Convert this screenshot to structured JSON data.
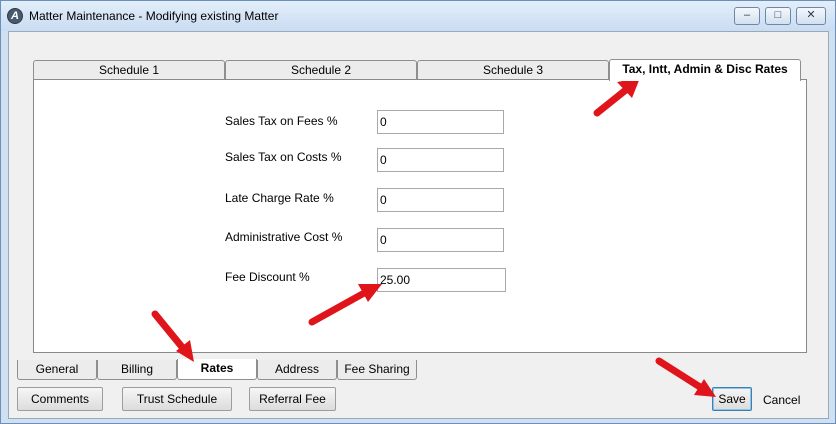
{
  "window": {
    "title": "Matter Maintenance - Modifying existing Matter",
    "min_glyph": "–",
    "max_glyph": "□",
    "close_glyph": "✕"
  },
  "top_tabs": [
    {
      "label": "Schedule 1",
      "active": false
    },
    {
      "label": "Schedule 2",
      "active": false
    },
    {
      "label": "Schedule 3",
      "active": false
    },
    {
      "label": "Tax, Intt, Admin & Disc Rates",
      "active": true
    }
  ],
  "fields": [
    {
      "label": "Sales Tax on Fees %",
      "value": "0"
    },
    {
      "label": "Sales Tax on Costs %",
      "value": "0"
    },
    {
      "label": "Late Charge Rate %",
      "value": "0"
    },
    {
      "label": "Administrative Cost %",
      "value": "0"
    },
    {
      "label": "Fee Discount %",
      "value": "25.00"
    }
  ],
  "bottom_tabs": [
    {
      "label": "General",
      "active": false
    },
    {
      "label": "Billing",
      "active": false
    },
    {
      "label": "Rates",
      "active": true
    },
    {
      "label": "Address",
      "active": false
    },
    {
      "label": "Fee Sharing",
      "active": false
    }
  ],
  "buttons": {
    "comments": "Comments",
    "trust_schedule": "Trust Schedule",
    "referral_fee": "Referral Fee",
    "save": "Save",
    "cancel": "Cancel"
  },
  "colors": {
    "annotation_arrow": "#e0141b",
    "title_bar": "#c9dcf2"
  }
}
